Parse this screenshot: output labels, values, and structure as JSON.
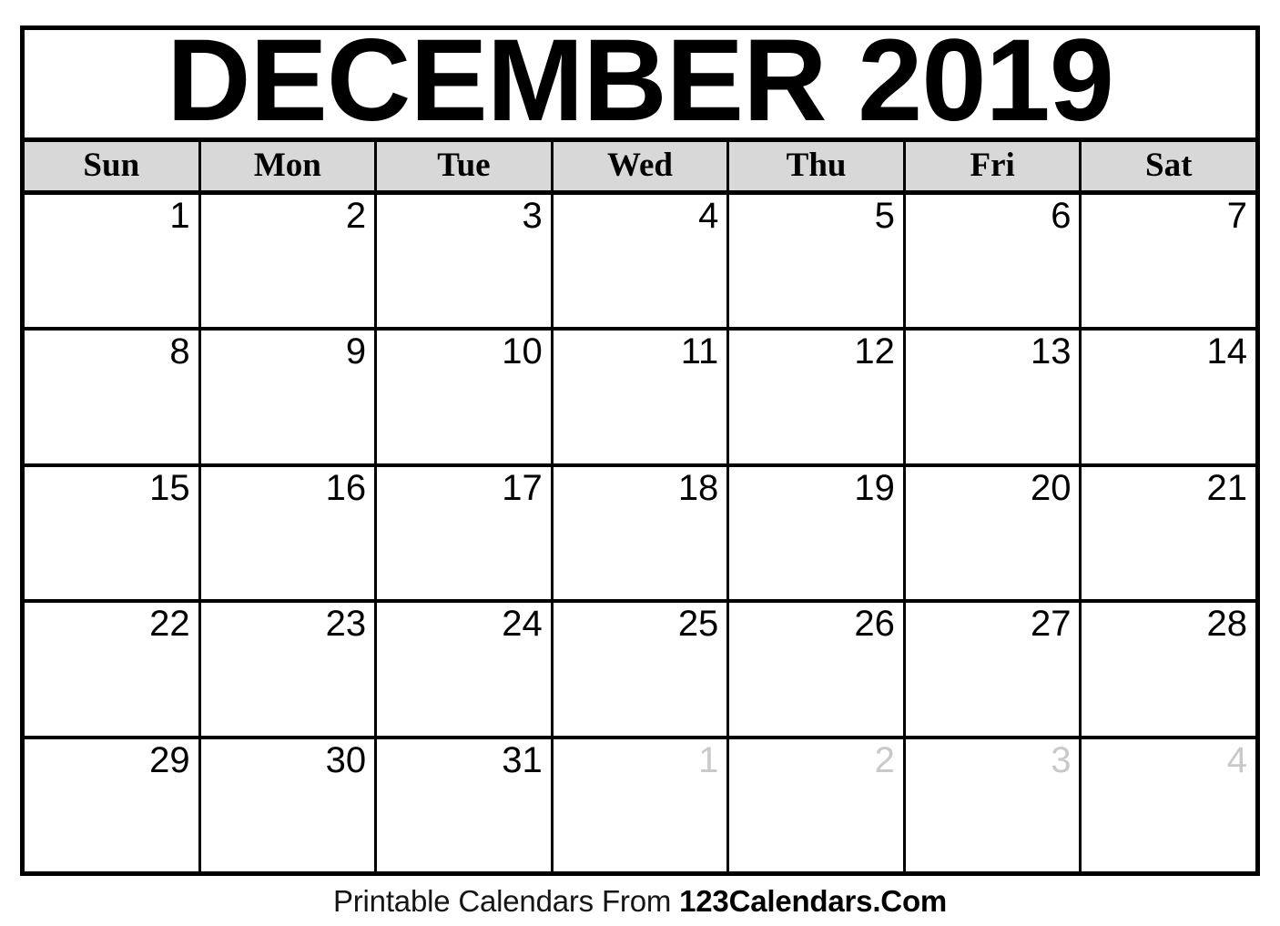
{
  "calendar": {
    "title": "DECEMBER 2019",
    "month": "December",
    "year": "2019",
    "weekdays": [
      {
        "label": "Sun"
      },
      {
        "label": "Mon"
      },
      {
        "label": "Tue"
      },
      {
        "label": "Wed"
      },
      {
        "label": "Thu"
      },
      {
        "label": "Fri"
      },
      {
        "label": "Sat"
      }
    ],
    "weeks": [
      {
        "days": [
          {
            "number": "1",
            "other_month": false
          },
          {
            "number": "2",
            "other_month": false
          },
          {
            "number": "3",
            "other_month": false
          },
          {
            "number": "4",
            "other_month": false
          },
          {
            "number": "5",
            "other_month": false
          },
          {
            "number": "6",
            "other_month": false
          },
          {
            "number": "7",
            "other_month": false
          }
        ]
      },
      {
        "days": [
          {
            "number": "8",
            "other_month": false
          },
          {
            "number": "9",
            "other_month": false
          },
          {
            "number": "10",
            "other_month": false
          },
          {
            "number": "11",
            "other_month": false
          },
          {
            "number": "12",
            "other_month": false
          },
          {
            "number": "13",
            "other_month": false
          },
          {
            "number": "14",
            "other_month": false
          }
        ]
      },
      {
        "days": [
          {
            "number": "15",
            "other_month": false
          },
          {
            "number": "16",
            "other_month": false
          },
          {
            "number": "17",
            "other_month": false
          },
          {
            "number": "18",
            "other_month": false
          },
          {
            "number": "19",
            "other_month": false
          },
          {
            "number": "20",
            "other_month": false
          },
          {
            "number": "21",
            "other_month": false
          }
        ]
      },
      {
        "days": [
          {
            "number": "22",
            "other_month": false
          },
          {
            "number": "23",
            "other_month": false
          },
          {
            "number": "24",
            "other_month": false
          },
          {
            "number": "25",
            "other_month": false
          },
          {
            "number": "26",
            "other_month": false
          },
          {
            "number": "27",
            "other_month": false
          },
          {
            "number": "28",
            "other_month": false
          }
        ]
      },
      {
        "days": [
          {
            "number": "29",
            "other_month": false
          },
          {
            "number": "30",
            "other_month": false
          },
          {
            "number": "31",
            "other_month": false
          },
          {
            "number": "1",
            "other_month": true
          },
          {
            "number": "2",
            "other_month": true
          },
          {
            "number": "3",
            "other_month": true
          },
          {
            "number": "4",
            "other_month": true
          }
        ]
      }
    ]
  },
  "footer": {
    "prefix": "Printable Calendars From ",
    "brand": "123Calendars.Com"
  },
  "colors": {
    "border": "#000000",
    "weekday_header_bg": "#d8d8d8",
    "text": "#000000",
    "other_month_text": "#c9c9c9",
    "page_bg": "#ffffff"
  }
}
